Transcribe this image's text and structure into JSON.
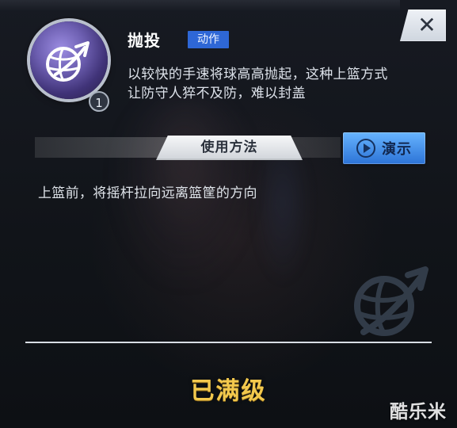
{
  "panel": {
    "title": "抛投",
    "tag": "动作",
    "level": "1",
    "description_lines": [
      "以较快的手速将球高高抛起，这种上篮方式",
      "让防守人猝不及防，难以封盖"
    ],
    "section_title": "使用方法",
    "demo_label": "演示",
    "usage_text": "上篮前，将摇杆拉向远离篮筐的方向",
    "status_text": "已满级",
    "watermark": "酷乐米"
  },
  "icons": {
    "close": "close-icon",
    "skill": "basketball-arrow-icon",
    "demo": "play-circle-icon",
    "ghost": "basketball-arrow-icon"
  },
  "colors": {
    "accent_blue": "#2e67d6",
    "button_blue_top": "#67b4ff",
    "button_blue_bottom": "#2c73d7",
    "gold": "#f2c84d",
    "badge_purple": "#6d5fb1"
  }
}
